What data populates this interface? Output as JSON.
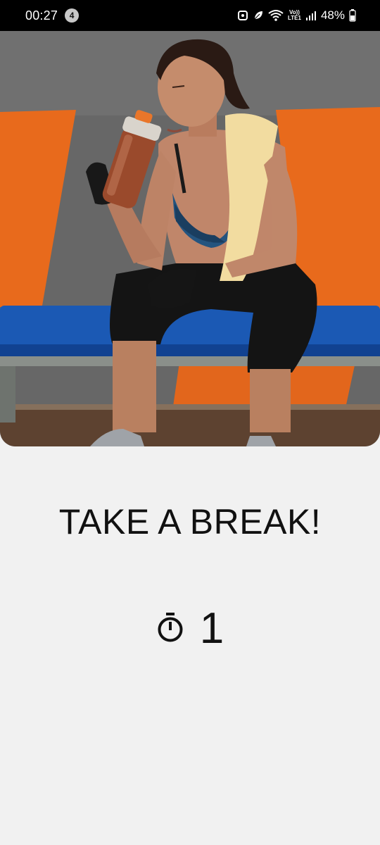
{
  "status_bar": {
    "time": "00:27",
    "notification_count": "4",
    "volte_top": "Vo))",
    "volte_bottom": "LTE1",
    "battery": "48%"
  },
  "hero": {
    "icon": "woman-resting-with-water-bottle-photo"
  },
  "screen": {
    "title": "TAKE A BREAK!",
    "timer_icon": "stopwatch-icon",
    "timer_value": "1"
  }
}
